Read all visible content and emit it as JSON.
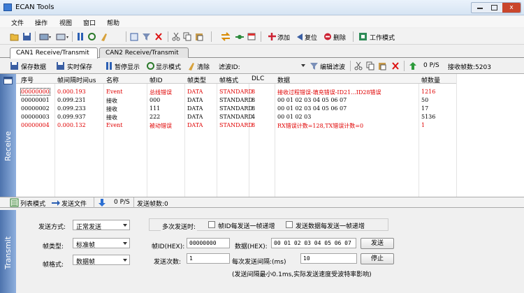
{
  "window": {
    "title": "ECAN Tools",
    "close": "x"
  },
  "menu": [
    "文件",
    "操作",
    "视图",
    "窗口",
    "帮助"
  ],
  "toolbar1": {
    "add": "添加",
    "reset": "复位",
    "delete": "删除",
    "work_mode": "工作模式"
  },
  "tabs": [
    "CAN1 Receive/Transmit",
    "CAN2 Receive/Transmit"
  ],
  "toolbar2": {
    "save_data": "保存数据",
    "realtime_save": "实时保存",
    "pause_display": "暂停显示",
    "display_mode": "显示模式",
    "clear": "清除",
    "filter_label": "滤波ID:",
    "edit_filter": "编辑滤波",
    "rate": "0 P/S",
    "rx_count": "接收帧数:5203"
  },
  "receive": {
    "side_label": "Receive",
    "columns": [
      "序号",
      "帧间隔时间us",
      "名称",
      "帧ID",
      "帧类型",
      "帧格式",
      "DLC",
      "数据",
      "帧数量"
    ],
    "rows": [
      [
        "00000000",
        "0.000.193",
        "Event",
        "总线错误",
        "DATA",
        "STANDARD",
        "8",
        "接收过程错误-填充错误-ID21...ID28错误",
        "1216"
      ],
      [
        "00000001",
        "0.099.231",
        "接收",
        "000",
        "DATA",
        "STANDARD",
        "8",
        "00 01 02 03 04 05 06 07",
        "50"
      ],
      [
        "00000002",
        "0.099.233",
        "接收",
        "111",
        "DATA",
        "STANDARD",
        "8",
        "00 01 02 03 04 05 06 07",
        "17"
      ],
      [
        "00000003",
        "0.099.937",
        "接收",
        "222",
        "DATA",
        "STANDARD",
        "4",
        "00 01 02 03",
        "5136"
      ],
      [
        "00000004",
        "0.000.132",
        "Event",
        "被动错误",
        "DATA",
        "STANDARD",
        "8",
        "RX错误计数=128,TX错误计数=0",
        "1"
      ]
    ],
    "red_rows": [
      0,
      4
    ]
  },
  "toolbar3": {
    "list_mode": "列表模式",
    "send_file": "发送文件",
    "rate": "0 P/S",
    "tx_count": "发送帧数:0"
  },
  "transmit": {
    "side_label": "Transmit",
    "send_mode_label": "发送方式:",
    "send_mode_value": "正常发送",
    "multi_send_label": "多次发送时:",
    "frame_id_inc_label": "帧ID每发送一帧递增",
    "data_inc_label": "发送数据每发送一帧递增",
    "frame_type_label": "帧类型:",
    "frame_type_value": "标准帧",
    "frame_id_label": "帧ID(HEX):",
    "frame_id_value": "00000000",
    "data_label": "数据(HEX):",
    "data_value": "00 01 02 03 04 05 06 07",
    "send_button": "发送",
    "frame_format_label": "帧格式:",
    "frame_format_value": "数据帧",
    "send_times_label": "发送次数:",
    "send_times_value": "1",
    "interval_label": "每次发送间隔:(ms)",
    "interval_value": "10",
    "stop_button": "停止",
    "note": "(发送间隔最小0.1ms,实际发送速度受波特率影响)"
  }
}
